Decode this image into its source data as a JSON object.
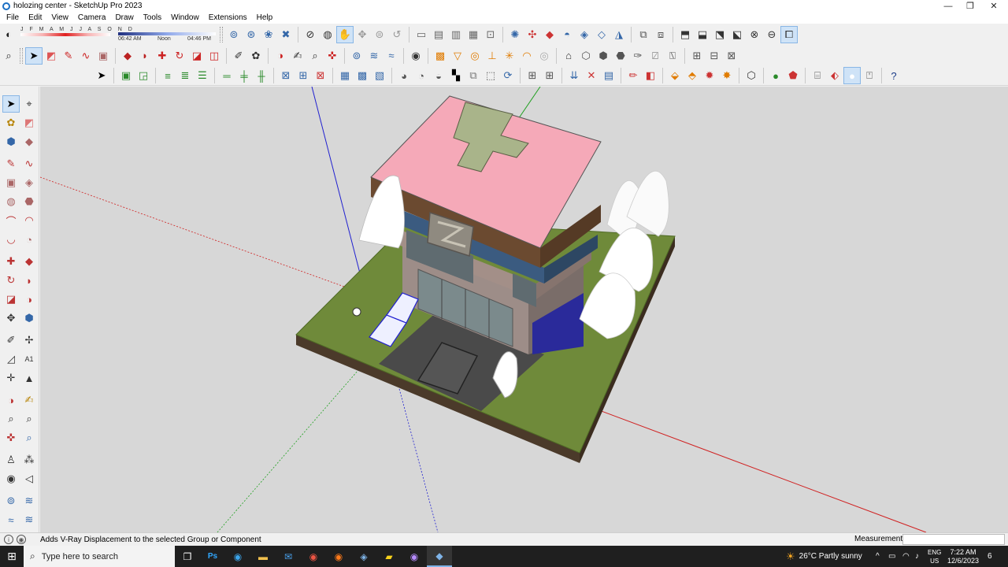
{
  "window": {
    "title": "holozing center - SketchUp Pro 2023",
    "controls": {
      "minimize": "—",
      "maximize": "❐",
      "close": "✕"
    }
  },
  "menu": [
    "File",
    "Edit",
    "View",
    "Camera",
    "Draw",
    "Tools",
    "Window",
    "Extensions",
    "Help"
  ],
  "shadow": {
    "months": "J F M A M J J A S O N D",
    "time_start": "06:42 AM",
    "time_mid": "Noon",
    "time_end": "04:46 PM"
  },
  "status": {
    "hint": "Adds V-Ray Displacement to the selected Group or Component",
    "measurements_label": "Measurements",
    "measurements_value": ""
  },
  "taskbar": {
    "search_placeholder": "Type here to search",
    "weather": "26°C  Partly sunny",
    "lang_top": "ENG",
    "lang_bottom": "US",
    "time": "7:22 AM",
    "date": "12/6/2023",
    "notifications": "6"
  },
  "colors": {
    "accent": "#3467a8",
    "viewport_bg": "#d7d7d7",
    "roof": "#f5a9b8",
    "grass": "#6f8a3a",
    "axis_red": "#d02020",
    "axis_green": "#20a020",
    "axis_blue": "#2020d0"
  }
}
